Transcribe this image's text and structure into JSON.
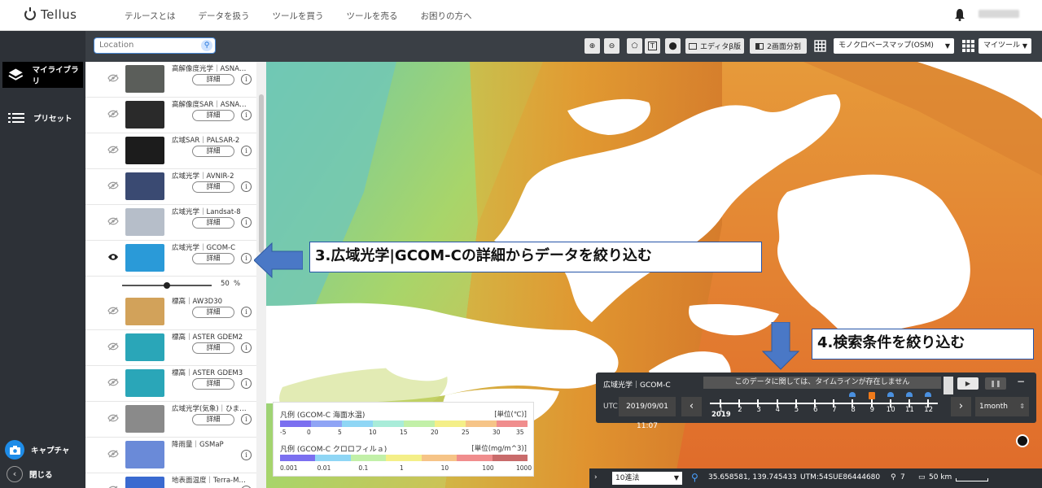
{
  "app": {
    "logo": "Tellus",
    "nav": [
      "テルースとは",
      "データを扱う",
      "ツールを買う",
      "ツールを売る",
      "お困りの方へ"
    ]
  },
  "rail": {
    "library": "マイライブラリ",
    "preset": "プリセット",
    "capture": "キャプチャ",
    "close": "閉じる"
  },
  "toolbar": {
    "search_placeholder": "Location",
    "editor": "エディタβ版",
    "split": "2画面分割",
    "basemap": "モノクロベースマップ(OSM)",
    "mytools": "マイツール"
  },
  "layers": [
    {
      "name": "高解像度光学｜ASNA…",
      "detail": "詳細",
      "visible": false,
      "thumb": "#5b5e5a"
    },
    {
      "name": "高解像度SAR｜ASNA…",
      "detail": "詳細",
      "visible": false,
      "thumb": "#2a2a2a"
    },
    {
      "name": "広域SAR｜PALSAR-2",
      "detail": "詳細",
      "visible": false,
      "thumb": "#1c1c1c"
    },
    {
      "name": "広域光学｜AVNIR-2",
      "detail": "詳細",
      "visible": false,
      "thumb": "#3a4a72"
    },
    {
      "name": "広域光学｜Landsat-8",
      "detail": "詳細",
      "visible": false,
      "thumb": "#b6bec9"
    },
    {
      "name": "広域光学｜GCOM-C",
      "detail": "詳細",
      "visible": true,
      "thumb": "#2a9ad8"
    },
    {
      "name": "標高｜AW3D30",
      "detail": "詳細",
      "visible": false,
      "thumb": "#d2a25a"
    },
    {
      "name": "標高｜ASTER GDEM2",
      "detail": "詳細",
      "visible": false,
      "thumb": "#2aa6b8"
    },
    {
      "name": "標高｜ASTER GDEM3",
      "detail": "詳細",
      "visible": false,
      "thumb": "#2aa6b8"
    },
    {
      "name": "広域光学(気象)｜ひま…",
      "detail": "詳細",
      "visible": false,
      "thumb": "#8a8a8a"
    },
    {
      "name": "降雨量｜GSMaP",
      "detail": "",
      "visible": false,
      "thumb": "#6a8ad8"
    },
    {
      "name": "地表面温度｜Terra-M…",
      "detail": "",
      "visible": false,
      "thumb": "#3a6ad0"
    }
  ],
  "opacity": {
    "value": 50,
    "unit": "%"
  },
  "legend": {
    "sst_title": "凡例 (GCOM-C 海面水温)",
    "sst_unit": "[単位(℃)]",
    "sst_ticks": [
      "-5",
      "0",
      "5",
      "10",
      "15",
      "20",
      "25",
      "30",
      "35"
    ],
    "chl_title": "凡例 (GCOM-C クロロフィルａ)",
    "chl_unit": "[単位(mg/m^3)]",
    "chl_ticks": [
      "0.001",
      "0.01",
      "0.1",
      "1",
      "10",
      "100",
      "1000"
    ],
    "sst_colors": [
      "#7b6ff0",
      "#8fa4f5",
      "#8fd6f5",
      "#a9ecd9",
      "#c2f0a8",
      "#f4ef88",
      "#f6c487",
      "#f08d8d"
    ],
    "chl_colors": [
      "#7b6ff0",
      "#8fd6f5",
      "#c2f0a8",
      "#f4ef88",
      "#f6c487",
      "#f08d8d",
      "#c96b6b"
    ]
  },
  "timeline": {
    "layer": "広域光学｜GCOM-C",
    "message": "このデータに関しては、タイムラインが存在しません",
    "utc": "UTC",
    "date": "2019/09/01 11:07",
    "year": "2019",
    "months": [
      "1",
      "2",
      "3",
      "4",
      "5",
      "6",
      "7",
      "8",
      "9",
      "10",
      "11",
      "12"
    ],
    "period": "1month",
    "minimize": "−"
  },
  "status": {
    "format": "10進法",
    "coords": "35.658581, 139.745433",
    "utm": "UTM:54SUE86444680",
    "zoom": "7",
    "scale": "50 km"
  },
  "callouts": {
    "step3": "3.広域光学|GCOM-Cの詳細からデータを絞り込む",
    "step4": "4.検索条件を絞り込む"
  },
  "colors": {
    "accent": "#2453a8",
    "arrow": "#4a78c6"
  }
}
